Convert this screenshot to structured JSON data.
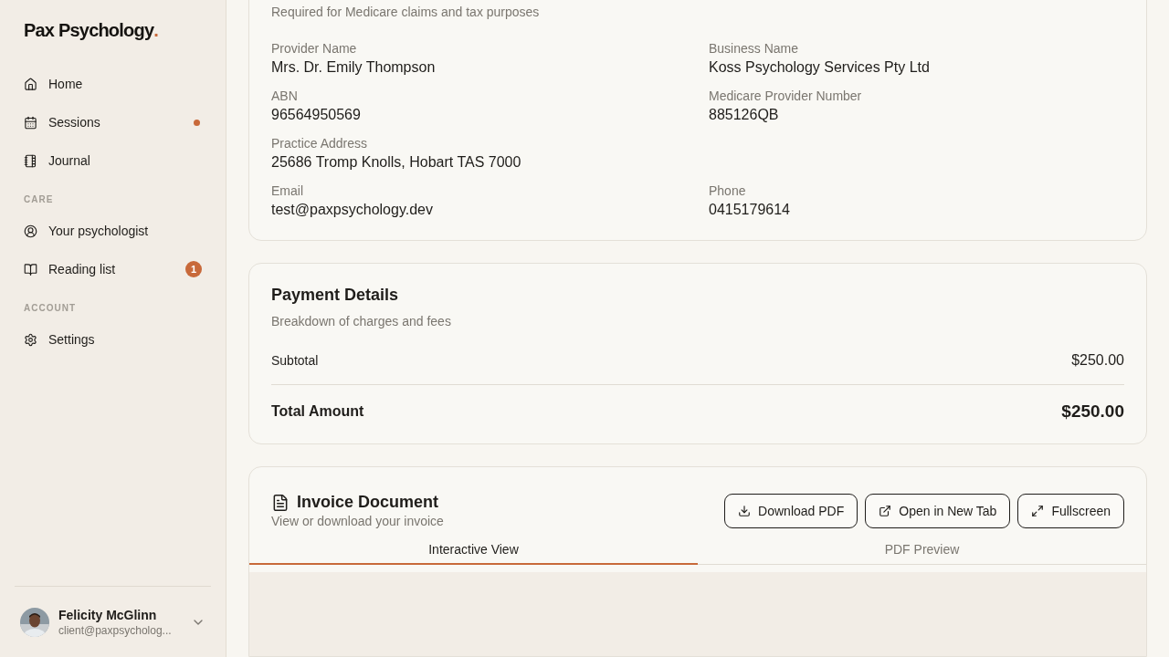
{
  "sidebar": {
    "logo": {
      "name": "Pax Psychology",
      "mark": "."
    },
    "sections": [
      {
        "items": [
          {
            "label": "Home",
            "kind": "plain"
          },
          {
            "label": "Sessions",
            "kind": "dot",
            "color": "#c8693a"
          },
          {
            "label": "Journal",
            "kind": "plain"
          }
        ]
      },
      {
        "heading": "CARE",
        "items": [
          {
            "label": "Your psychologist",
            "kind": "plain"
          },
          {
            "label": "Reading list",
            "kind": "badge",
            "badge": "1",
            "color": "#c8693a"
          }
        ]
      },
      {
        "heading": "ACCOUNT",
        "items": [
          {
            "label": "Settings",
            "kind": "plain"
          }
        ]
      }
    ],
    "user": {
      "name": "Felicity McGlinn",
      "email": "client@paxpsycholog..."
    }
  },
  "provider": {
    "subtitle": "Required for Medicare claims and tax purposes",
    "rows": [
      [
        {
          "label": "Provider Name",
          "value": "Mrs. Dr. Emily Thompson"
        },
        {
          "label": "Business Name",
          "value": "Koss Psychology Services Pty Ltd"
        }
      ],
      [
        {
          "label": "ABN",
          "value": "96564950569"
        },
        {
          "label": "Medicare Provider Number",
          "value": "885126QB"
        }
      ],
      [
        {
          "label": "Practice Address",
          "value": "25686 Tromp Knolls, Hobart TAS 7000"
        }
      ],
      [
        {
          "label": "Email",
          "value": "test@paxpsychology.dev"
        },
        {
          "label": "Phone",
          "value": "0415179614"
        }
      ]
    ]
  },
  "payment": {
    "title": "Payment Details",
    "subtitle": "Breakdown of charges and fees",
    "lines": [
      {
        "label": "Subtotal",
        "value": "$250.00",
        "kind": "line"
      },
      {
        "label": "Total Amount",
        "value": "$250.00",
        "kind": "total"
      }
    ]
  },
  "invoice": {
    "title": "Invoice Document",
    "subtitle": "View or download your invoice",
    "buttons": [
      {
        "label": "Download PDF"
      },
      {
        "label": "Open in New Tab"
      },
      {
        "label": "Fullscreen"
      }
    ],
    "tabs": [
      {
        "label": "Interactive View",
        "selected": true
      },
      {
        "label": "PDF Preview",
        "selected": false
      }
    ]
  }
}
